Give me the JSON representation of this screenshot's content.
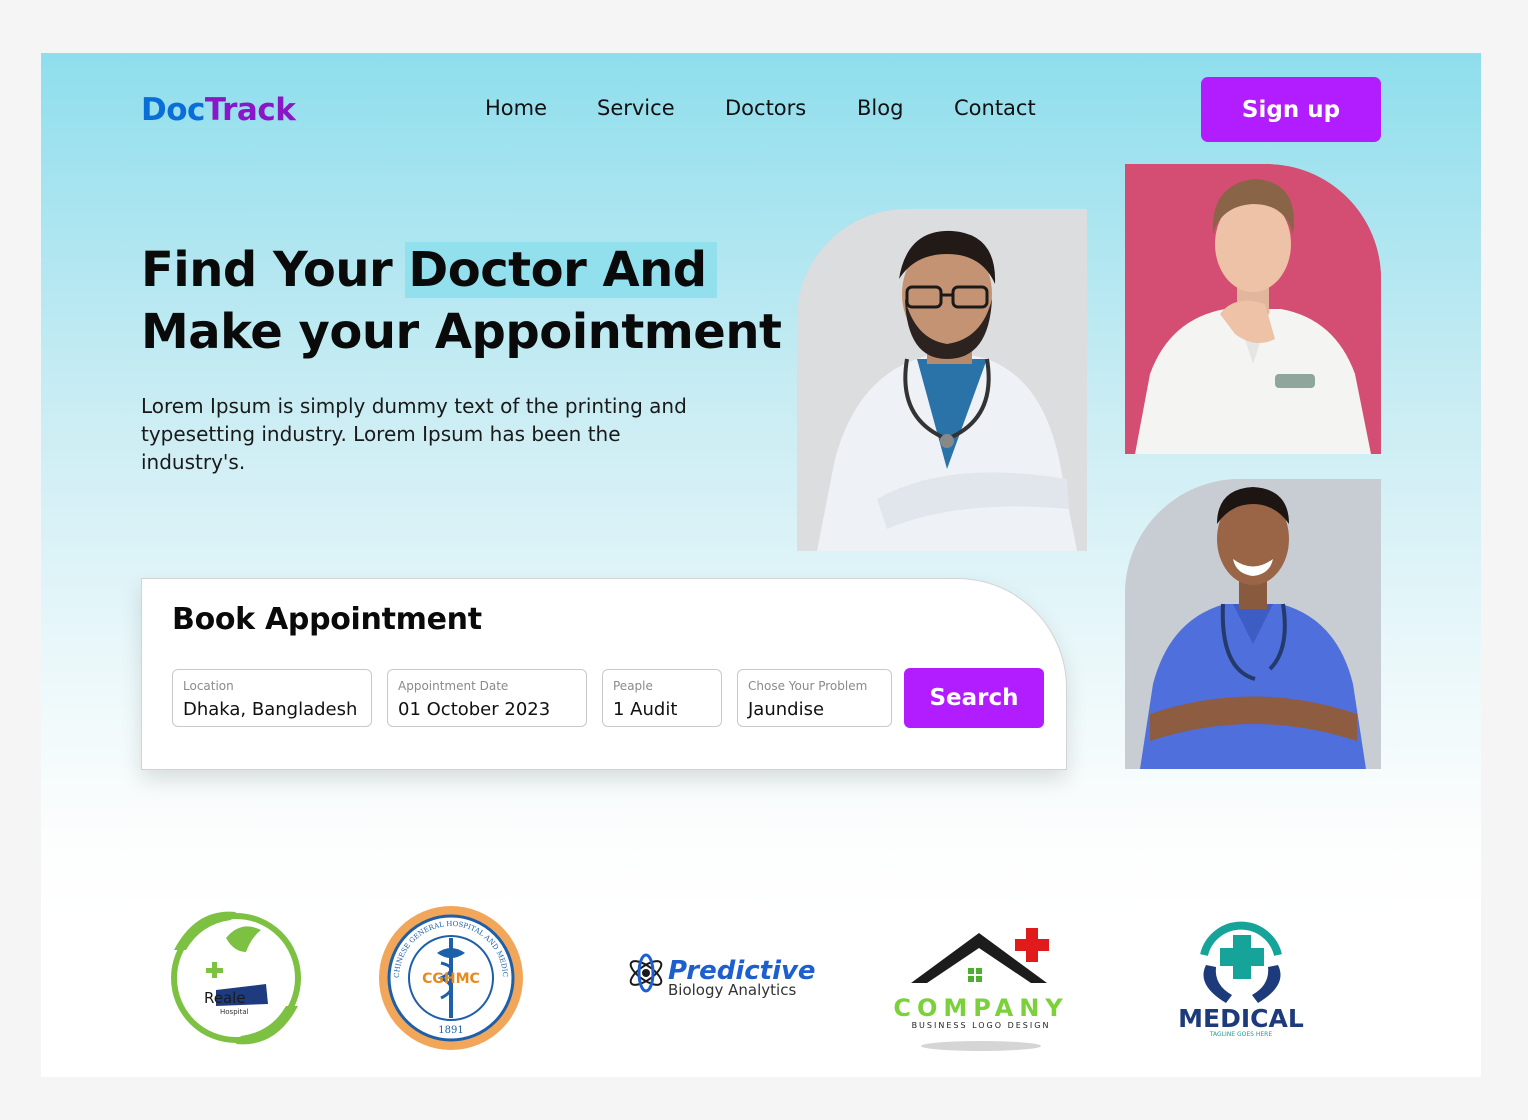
{
  "brand": {
    "part1": "Doc",
    "part2": "Track"
  },
  "nav": {
    "items": [
      "Home",
      "Service",
      "Doctors",
      "Blog",
      "Contact"
    ],
    "signup_label": "Sign up"
  },
  "hero": {
    "title_line1_pre": "Find Your ",
    "title_line1_highlight": "Doctor And",
    "title_line2": "Make your Appointment",
    "description": "Lorem Ipsum is simply dummy text of the printing and typesetting industry. Lorem Ipsum has been the industry's."
  },
  "booking": {
    "title": "Book Appointment",
    "fields": [
      {
        "label": "Location",
        "value": "Dhaka, Bangladesh"
      },
      {
        "label": "Appointment Date",
        "value": "01 October 2023"
      },
      {
        "label": "Peaple",
        "value": "1 Audit"
      },
      {
        "label": "Chose Your Problem",
        "value": "Jaundise"
      }
    ],
    "search_label": "Search"
  },
  "partners": [
    {
      "name": "Reale",
      "sub": "Hospital",
      "icon": "dove-hand-icon"
    },
    {
      "name": "CGHMC",
      "ring": "CHINESE GENERAL HOSPITAL AND MEDICAL CENTER",
      "year": "1891",
      "icon": "caduceus-icon"
    },
    {
      "name": "Predictive",
      "sub": "Biology Analytics",
      "icon": "atom-icon"
    },
    {
      "name": "COMPANY",
      "sub": "BUSINESS LOGO DESIGN",
      "icon": "house-cross-icon"
    },
    {
      "name": "MEDICAL",
      "sub": "TAGLINE GOES HERE",
      "icon": "cross-hands-icon"
    }
  ],
  "colors": {
    "accent": "#b21dff",
    "brand_blue": "#0a6ed8",
    "brand_purple": "#8a17c7",
    "highlight": "#92e0ee"
  }
}
